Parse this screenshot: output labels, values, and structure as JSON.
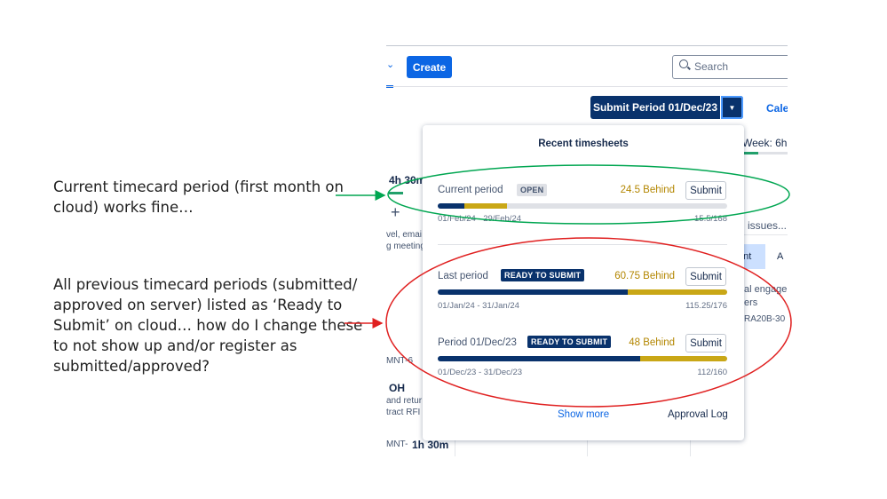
{
  "annotations": {
    "note1": [
      "Current timecard period (first month on",
      "cloud) works fine…"
    ],
    "note2": [
      "All previous timecard periods (submitted/",
      "approved on server) listed as ‘Ready to",
      "Submit’ on cloud… how do I change these",
      "to not show up and/or register as",
      "submitted/approved?"
    ]
  },
  "header": {
    "create_label": "Create",
    "search_placeholder": "Search",
    "submit_period_label": "Submit Period 01/Dec/23",
    "calendar_tab": "Cale",
    "week_label": "Week: 6h"
  },
  "background": {
    "hours_top": "4h 30m",
    "plus": "+",
    "issues_text": "issues...",
    "text_a": "vel, emai",
    "text_b": "g meeting",
    "cell_nt": "ant",
    "cell_a": "A",
    "text_c": "al engage",
    "text_d": "ers",
    "text_e": "RA20B-30",
    "text_f": "MNT-6",
    "oh": "OH",
    "text_g": "and retur",
    "text_h": "tract RFI f",
    "text_i": "MNT-",
    "hours_bottom": "1h 30m"
  },
  "popup": {
    "title": "Recent timesheets",
    "periods": [
      {
        "label": "Current period",
        "status": "OPEN",
        "behind": "24.5 Behind",
        "button": "Submit",
        "dates": "01/Feb/24 - 29/Feb/24",
        "hours": "15.5/168",
        "done_fraction": 0.092,
        "behind_fraction": 0.146
      },
      {
        "label": "Last period",
        "status": "READY TO SUBMIT",
        "behind": "60.75 Behind",
        "button": "Submit",
        "dates": "01/Jan/24 - 31/Jan/24",
        "hours": "115.25/176",
        "done_fraction": 0.655,
        "behind_fraction": 0.345
      },
      {
        "label": "Period 01/Dec/23",
        "status": "READY TO SUBMIT",
        "behind": "48 Behind",
        "button": "Submit",
        "dates": "01/Dec/23 - 31/Dec/23",
        "hours": "112/160",
        "done_fraction": 0.7,
        "behind_fraction": 0.3
      }
    ],
    "show_more": "Show more",
    "approval_log": "Approval Log"
  },
  "colors": {
    "green_annotation": "#00a651",
    "red_annotation": "#e02020",
    "progress_done": "#09326c",
    "progress_behind": "#c9a716"
  }
}
